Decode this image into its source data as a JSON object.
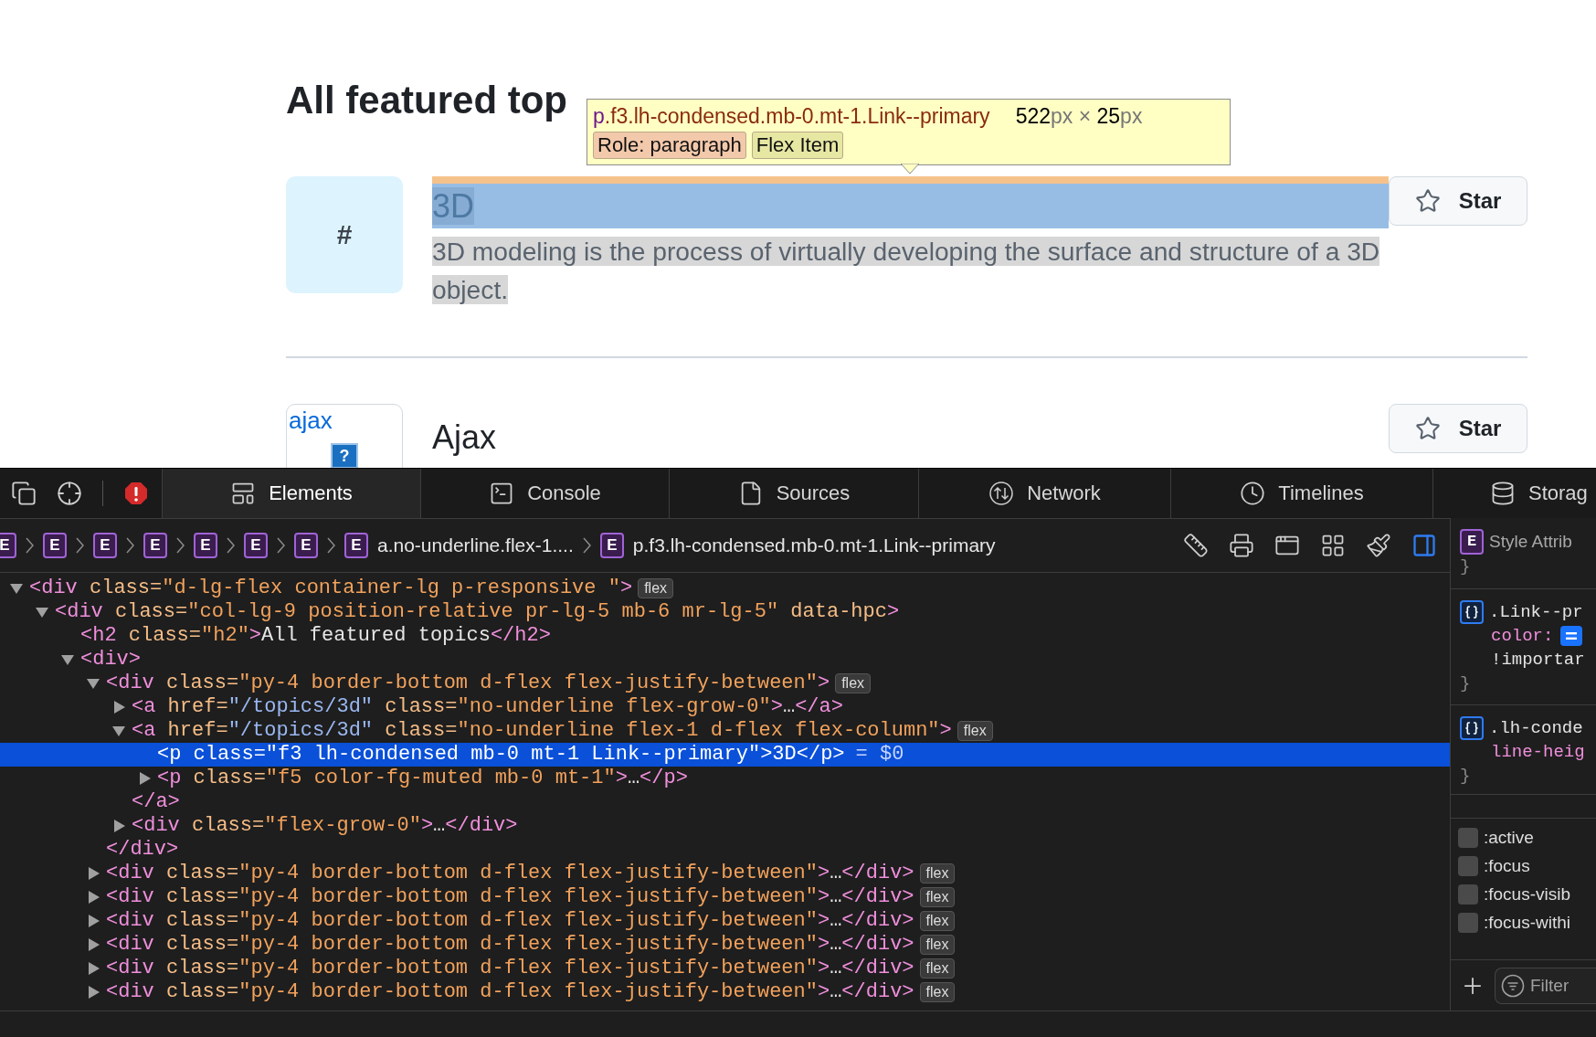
{
  "page": {
    "heading": "All featured top",
    "topics": [
      {
        "kind": "hash",
        "logo_text": "#",
        "title": "3D",
        "description": "3D modeling is the process of virtually developing the surface and structure of a 3D object.",
        "highlighted": true,
        "star": "Star"
      },
      {
        "kind": "image",
        "logo_text": "ajax",
        "logo_glyph": "?",
        "title": "Ajax",
        "highlighted": false,
        "star": "Star"
      }
    ],
    "inspector_tooltip": {
      "tag": "p",
      "classes": ".f3.lh-condensed.mb-0.mt-1.Link--primary",
      "size": [
        {
          "value": "522",
          "unit": "px"
        },
        {
          "value": "25",
          "unit": "px"
        }
      ],
      "times": "×",
      "badges": [
        {
          "label": "Role: paragraph",
          "color": "#f3c9ab"
        },
        {
          "label": "Flex Item",
          "color": "#e6e7a3"
        }
      ]
    }
  },
  "devtools": {
    "tabs": [
      {
        "label": "Elements",
        "selected": true
      },
      {
        "label": "Console",
        "selected": false
      },
      {
        "label": "Sources",
        "selected": false
      },
      {
        "label": "Network",
        "selected": false
      },
      {
        "label": "Timelines",
        "selected": false
      },
      {
        "label": "Storag",
        "selected": false
      }
    ],
    "breadcrumbs": [
      {
        "badge": "E"
      },
      {
        "badge": "E"
      },
      {
        "badge": "E"
      },
      {
        "badge": "E"
      },
      {
        "badge": "E"
      },
      {
        "badge": "E"
      },
      {
        "badge": "E"
      },
      {
        "badge": "E",
        "label": "a.no-underline.flex-1...."
      },
      {
        "badge": "E",
        "label": "p.f3.lh-condensed.mb-0.mt-1.Link--primary"
      }
    ],
    "dom_tree": [
      {
        "markup": "<div class=\"d-lg-flex container-lg p-responsive \">",
        "badge": "flex",
        "expanded": true,
        "selected": false,
        "children": [
          {
            "markup": "<div class=\"col-lg-9 position-relative pr-lg-5 mb-6 mr-lg-5\" data-hpc>",
            "expanded": true,
            "selected": false,
            "children": [
              {
                "markup": "<h2 class=\"h2\">All featured topics</h2>",
                "selected": false
              },
              {
                "markup": "<div>",
                "expanded": true,
                "selected": false,
                "children": [
                  {
                    "markup": "<div class=\"py-4 border-bottom d-flex flex-justify-between\">",
                    "badge": "flex",
                    "expanded": true,
                    "selected": false,
                    "closing": "</div>",
                    "children": [
                      {
                        "markup": "<a href=\"/topics/3d\" class=\"no-underline flex-grow-0\">…</a>",
                        "expanded": false,
                        "selected": false
                      },
                      {
                        "markup": "<a href=\"/topics/3d\" class=\"no-underline flex-1 d-flex flex-column\">",
                        "badge": "flex",
                        "expanded": true,
                        "selected": false,
                        "closing": "</a>",
                        "children": [
                          {
                            "markup": "<p class=\"f3 lh-condensed mb-0 mt-1 Link--primary\">3D</p>",
                            "note": "= $0",
                            "selected": true
                          },
                          {
                            "markup": "<p class=\"f5 color-fg-muted mb-0 mt-1\">…</p>",
                            "expanded": false,
                            "selected": false
                          }
                        ]
                      },
                      {
                        "markup": "<div class=\"flex-grow-0\">…</div>",
                        "expanded": false,
                        "selected": false
                      }
                    ]
                  },
                  {
                    "markup": "<div class=\"py-4 border-bottom d-flex flex-justify-between\">…</div>",
                    "badge": "flex",
                    "expanded": false,
                    "selected": false
                  },
                  {
                    "markup": "<div class=\"py-4 border-bottom d-flex flex-justify-between\">…</div>",
                    "badge": "flex",
                    "expanded": false,
                    "selected": false
                  },
                  {
                    "markup": "<div class=\"py-4 border-bottom d-flex flex-justify-between\">…</div>",
                    "badge": "flex",
                    "expanded": false,
                    "selected": false
                  },
                  {
                    "markup": "<div class=\"py-4 border-bottom d-flex flex-justify-between\">…</div>",
                    "badge": "flex",
                    "expanded": false,
                    "selected": false
                  },
                  {
                    "markup": "<div class=\"py-4 border-bottom d-flex flex-justify-between\">…</div>",
                    "badge": "flex",
                    "expanded": false,
                    "selected": false
                  },
                  {
                    "markup": "<div class=\"py-4 border-bottom d-flex flex-justify-between\">…</div>",
                    "badge": "flex",
                    "expanded": false,
                    "selected": false
                  }
                ]
              }
            ]
          }
        ]
      }
    ],
    "styles": {
      "rules": [
        {
          "kind": "attribute",
          "badge": "E",
          "title": "Style Attrib",
          "close": "}"
        },
        {
          "kind": "rule",
          "selector": ".Link--pr",
          "declarations": [
            {
              "property": "color:",
              "swatch": true,
              "value": "!importar"
            }
          ],
          "close": "}"
        },
        {
          "kind": "rule",
          "selector": ".lh-conde",
          "declarations": [
            {
              "property": "line-heig"
            }
          ],
          "close": "}"
        }
      ],
      "pseudo_classes": [
        {
          "label": ":active",
          "checked": false
        },
        {
          "label": ":focus",
          "checked": false
        },
        {
          "label": ":focus-visib",
          "checked": false
        },
        {
          "label": ":focus-withi",
          "checked": false
        }
      ],
      "filter": {
        "placeholder": "Filter"
      }
    }
  }
}
